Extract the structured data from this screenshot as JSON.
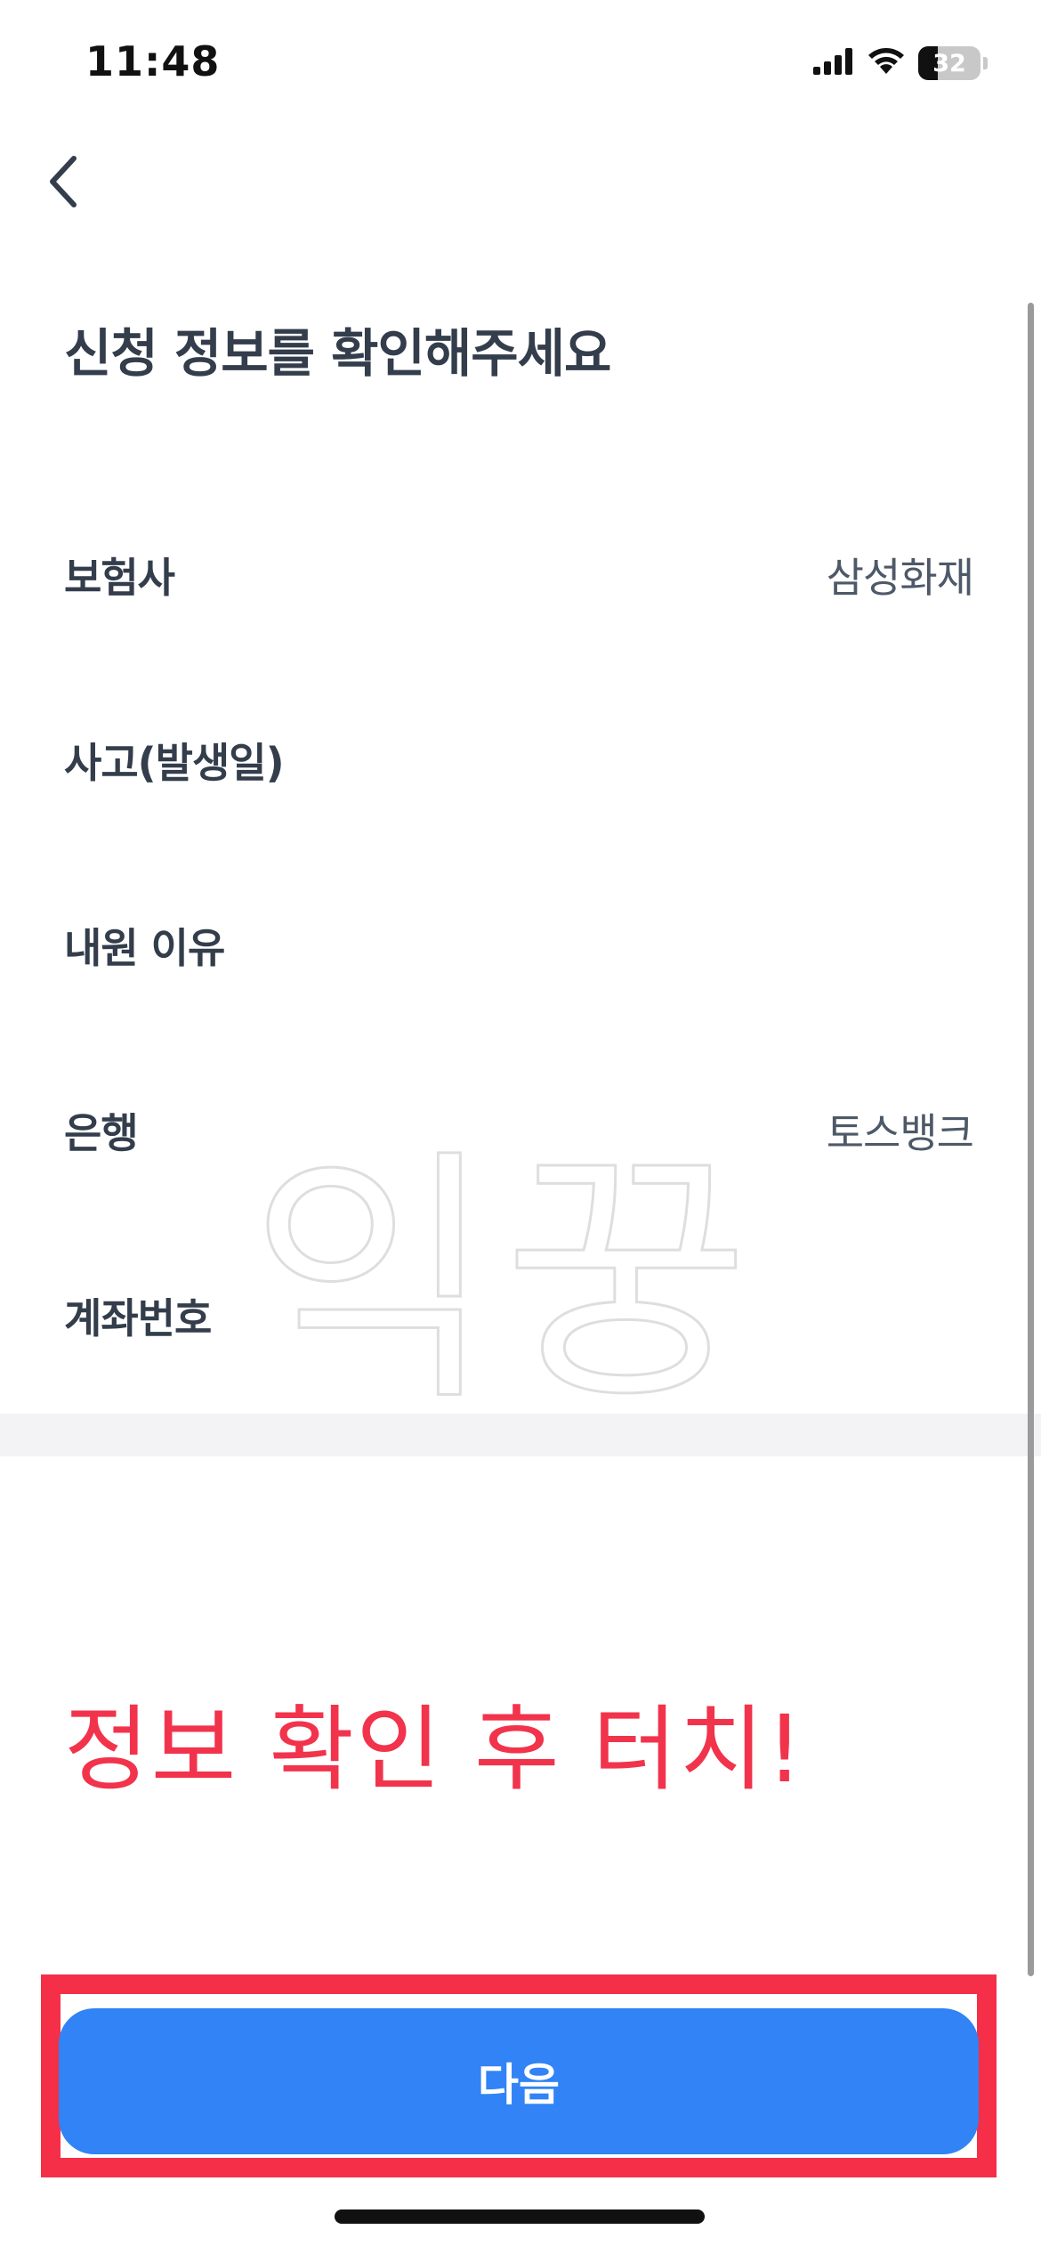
{
  "status_bar": {
    "time": "11:48",
    "battery_level": "32",
    "icons": [
      "cellular-signal-icon",
      "wifi-icon",
      "battery-icon"
    ]
  },
  "header": {
    "back_icon": "chevron-left-icon"
  },
  "title": "신청 정보를 확인해주세요",
  "rows": [
    {
      "label": "보험사",
      "value": "삼성화재"
    },
    {
      "label": "사고(발생일)",
      "value": ""
    },
    {
      "label": "내원 이유",
      "value": ""
    },
    {
      "label": "은행",
      "value": "토스뱅크"
    },
    {
      "label": "계좌번호",
      "value": ""
    }
  ],
  "watermark": "익꿍",
  "annotation": "정보 확인 후 터치!",
  "cta": {
    "label": "다음"
  },
  "colors": {
    "primary": "#3183f6",
    "annotation_red": "#f2334c",
    "text_dark": "#333d4b",
    "text_value": "#4e5968"
  }
}
